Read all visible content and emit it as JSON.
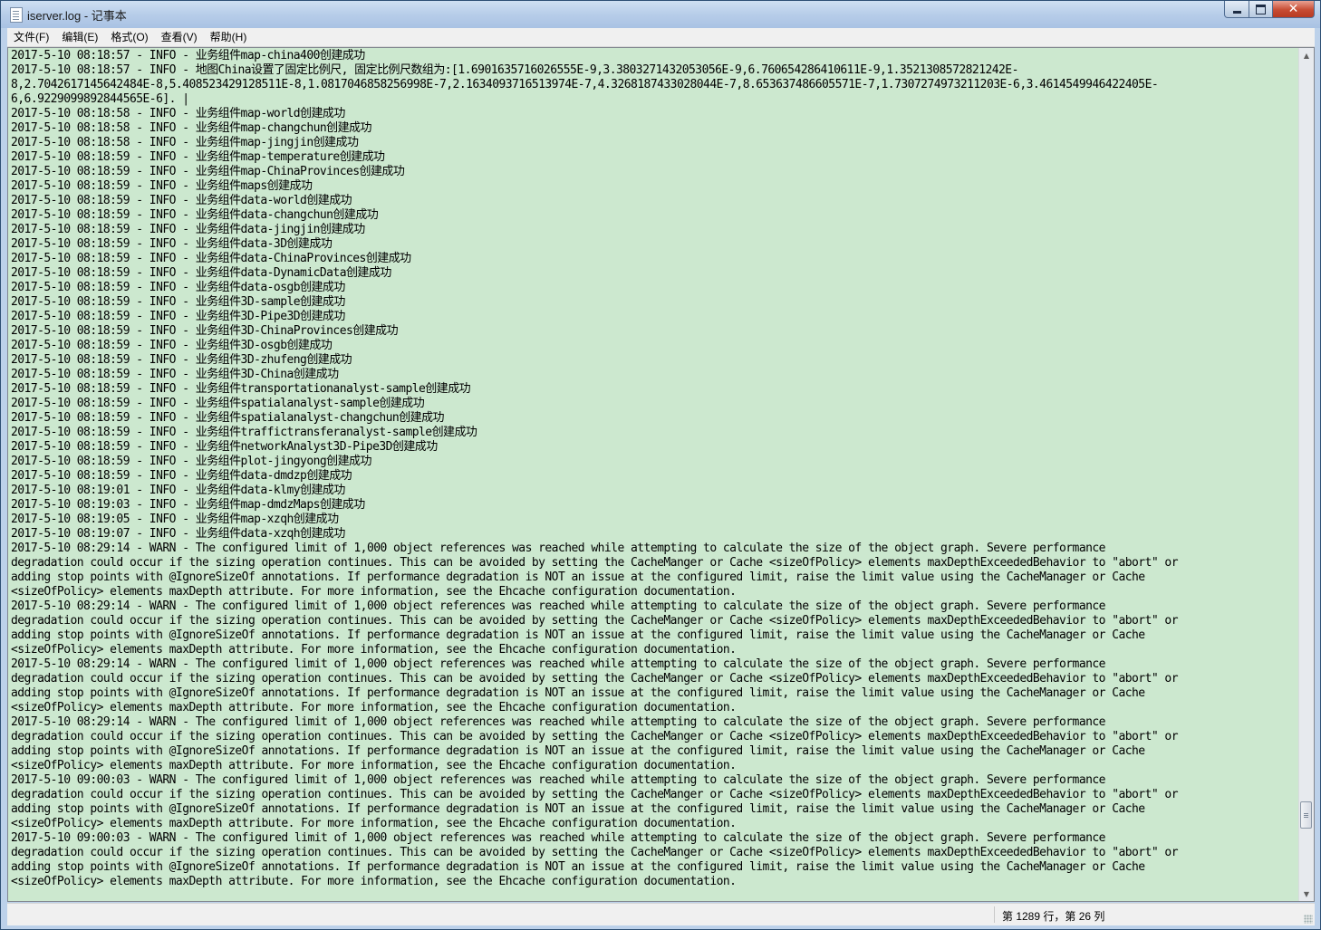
{
  "window": {
    "title": "iserver.log - 记事本",
    "minimize_icon": "minimize-icon",
    "maximize_icon": "maximize-icon",
    "close_icon": "close-icon",
    "close_glyph": "✕"
  },
  "menubar": {
    "items": [
      {
        "label": "文件(F)"
      },
      {
        "label": "编辑(E)"
      },
      {
        "label": "格式(O)"
      },
      {
        "label": "查看(V)"
      },
      {
        "label": "帮助(H)"
      }
    ]
  },
  "editor": {
    "background": "#cce8cf",
    "lines": [
      "2017-5-10 08:18:57 - INFO - 业务组件map-china400创建成功",
      "2017-5-10 08:18:57 - INFO - 地图China设置了固定比例尺, 固定比例尺数组为:[1.6901635716026555E-9,3.3803271432053056E-9,6.760654286410611E-9,1.3521308572821242E-",
      "8,2.7042617145642484E-8,5.408523429128511E-8,1.0817046858256998E-7,2.1634093716513974E-7,4.3268187433028044E-7,8.653637486605571E-7,1.7307274973211203E-6,3.4614549946422405E-",
      "6,6.9229099892844565E-6]. |",
      "2017-5-10 08:18:58 - INFO - 业务组件map-world创建成功",
      "2017-5-10 08:18:58 - INFO - 业务组件map-changchun创建成功",
      "2017-5-10 08:18:58 - INFO - 业务组件map-jingjin创建成功",
      "2017-5-10 08:18:59 - INFO - 业务组件map-temperature创建成功",
      "2017-5-10 08:18:59 - INFO - 业务组件map-ChinaProvinces创建成功",
      "2017-5-10 08:18:59 - INFO - 业务组件maps创建成功",
      "2017-5-10 08:18:59 - INFO - 业务组件data-world创建成功",
      "2017-5-10 08:18:59 - INFO - 业务组件data-changchun创建成功",
      "2017-5-10 08:18:59 - INFO - 业务组件data-jingjin创建成功",
      "2017-5-10 08:18:59 - INFO - 业务组件data-3D创建成功",
      "2017-5-10 08:18:59 - INFO - 业务组件data-ChinaProvinces创建成功",
      "2017-5-10 08:18:59 - INFO - 业务组件data-DynamicData创建成功",
      "2017-5-10 08:18:59 - INFO - 业务组件data-osgb创建成功",
      "2017-5-10 08:18:59 - INFO - 业务组件3D-sample创建成功",
      "2017-5-10 08:18:59 - INFO - 业务组件3D-Pipe3D创建成功",
      "2017-5-10 08:18:59 - INFO - 业务组件3D-ChinaProvinces创建成功",
      "2017-5-10 08:18:59 - INFO - 业务组件3D-osgb创建成功",
      "2017-5-10 08:18:59 - INFO - 业务组件3D-zhufeng创建成功",
      "2017-5-10 08:18:59 - INFO - 业务组件3D-China创建成功",
      "2017-5-10 08:18:59 - INFO - 业务组件transportationanalyst-sample创建成功",
      "2017-5-10 08:18:59 - INFO - 业务组件spatialanalyst-sample创建成功",
      "2017-5-10 08:18:59 - INFO - 业务组件spatialanalyst-changchun创建成功",
      "2017-5-10 08:18:59 - INFO - 业务组件traffictransferanalyst-sample创建成功",
      "2017-5-10 08:18:59 - INFO - 业务组件networkAnalyst3D-Pipe3D创建成功",
      "2017-5-10 08:18:59 - INFO - 业务组件plot-jingyong创建成功",
      "2017-5-10 08:18:59 - INFO - 业务组件data-dmdzp创建成功",
      "2017-5-10 08:19:01 - INFO - 业务组件data-klmy创建成功",
      "2017-5-10 08:19:03 - INFO - 业务组件map-dmdzMaps创建成功",
      "2017-5-10 08:19:05 - INFO - 业务组件map-xzqh创建成功",
      "2017-5-10 08:19:07 - INFO - 业务组件data-xzqh创建成功",
      "2017-5-10 08:29:14 - WARN - The configured limit of 1,000 object references was reached while attempting to calculate the size of the object graph. Severe performance",
      "degradation could occur if the sizing operation continues. This can be avoided by setting the CacheManger or Cache <sizeOfPolicy> elements maxDepthExceededBehavior to \"abort\" or",
      "adding stop points with @IgnoreSizeOf annotations. If performance degradation is NOT an issue at the configured limit, raise the limit value using the CacheManager or Cache",
      "<sizeOfPolicy> elements maxDepth attribute. For more information, see the Ehcache configuration documentation.",
      "2017-5-10 08:29:14 - WARN - The configured limit of 1,000 object references was reached while attempting to calculate the size of the object graph. Severe performance",
      "degradation could occur if the sizing operation continues. This can be avoided by setting the CacheManger or Cache <sizeOfPolicy> elements maxDepthExceededBehavior to \"abort\" or",
      "adding stop points with @IgnoreSizeOf annotations. If performance degradation is NOT an issue at the configured limit, raise the limit value using the CacheManager or Cache",
      "<sizeOfPolicy> elements maxDepth attribute. For more information, see the Ehcache configuration documentation.",
      "2017-5-10 08:29:14 - WARN - The configured limit of 1,000 object references was reached while attempting to calculate the size of the object graph. Severe performance",
      "degradation could occur if the sizing operation continues. This can be avoided by setting the CacheManger or Cache <sizeOfPolicy> elements maxDepthExceededBehavior to \"abort\" or",
      "adding stop points with @IgnoreSizeOf annotations. If performance degradation is NOT an issue at the configured limit, raise the limit value using the CacheManager or Cache",
      "<sizeOfPolicy> elements maxDepth attribute. For more information, see the Ehcache configuration documentation.",
      "2017-5-10 08:29:14 - WARN - The configured limit of 1,000 object references was reached while attempting to calculate the size of the object graph. Severe performance",
      "degradation could occur if the sizing operation continues. This can be avoided by setting the CacheManger or Cache <sizeOfPolicy> elements maxDepthExceededBehavior to \"abort\" or",
      "adding stop points with @IgnoreSizeOf annotations. If performance degradation is NOT an issue at the configured limit, raise the limit value using the CacheManager or Cache",
      "<sizeOfPolicy> elements maxDepth attribute. For more information, see the Ehcache configuration documentation.",
      "2017-5-10 09:00:03 - WARN - The configured limit of 1,000 object references was reached while attempting to calculate the size of the object graph. Severe performance",
      "degradation could occur if the sizing operation continues. This can be avoided by setting the CacheManger or Cache <sizeOfPolicy> elements maxDepthExceededBehavior to \"abort\" or",
      "adding stop points with @IgnoreSizeOf annotations. If performance degradation is NOT an issue at the configured limit, raise the limit value using the CacheManager or Cache",
      "<sizeOfPolicy> elements maxDepth attribute. For more information, see the Ehcache configuration documentation.",
      "2017-5-10 09:00:03 - WARN - The configured limit of 1,000 object references was reached while attempting to calculate the size of the object graph. Severe performance",
      "degradation could occur if the sizing operation continues. This can be avoided by setting the CacheManger or Cache <sizeOfPolicy> elements maxDepthExceededBehavior to \"abort\" or",
      "adding stop points with @IgnoreSizeOf annotations. If performance degradation is NOT an issue at the configured limit, raise the limit value using the CacheManager or Cache",
      "<sizeOfPolicy> elements maxDepth attribute. For more information, see the Ehcache configuration documentation."
    ],
    "scroll_up_glyph": "▲",
    "scroll_down_glyph": "▼"
  },
  "statusbar": {
    "position": "第 1289 行，第 26 列"
  }
}
